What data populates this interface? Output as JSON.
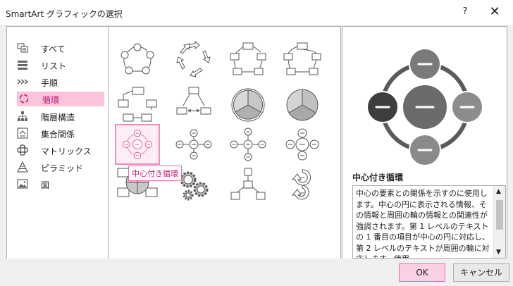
{
  "window": {
    "title": "SmartArt グラフィックの選択",
    "help_label": "?",
    "close_label": "✕"
  },
  "categories": [
    {
      "label": "すべて",
      "icon": "all-icon"
    },
    {
      "label": "リスト",
      "icon": "list-icon"
    },
    {
      "label": "手順",
      "icon": "process-icon"
    },
    {
      "label": "循環",
      "icon": "cycle-icon",
      "selected": true
    },
    {
      "label": "階層構造",
      "icon": "hierarchy-icon"
    },
    {
      "label": "集合関係",
      "icon": "relationship-icon"
    },
    {
      "label": "マトリックス",
      "icon": "matrix-icon"
    },
    {
      "label": "ピラミッド",
      "icon": "pyramid-icon"
    },
    {
      "label": "図",
      "icon": "picture-icon"
    }
  ],
  "gallery": {
    "tooltip": "中心付き循環",
    "selected_index": 8
  },
  "preview": {
    "name": "中心付き循環",
    "description": "中心の要素との関係を示すのに使用します。中心の円に表示される情報、その情報と周囲の輪の情報との関連性が強調されます。第 1 レベルのテキストの 1 番目の項目が中心の円に対応し、第 2 レベルのテキストが周囲の輪に対応します。使用"
  },
  "buttons": {
    "ok": "OK",
    "cancel": "キャンセル"
  },
  "colors": {
    "accent_pink": "#f08dbb",
    "selection_bg": "#f9c4dc",
    "preview_dark": "#5a5a5a",
    "preview_light": "#8c8c8c"
  }
}
